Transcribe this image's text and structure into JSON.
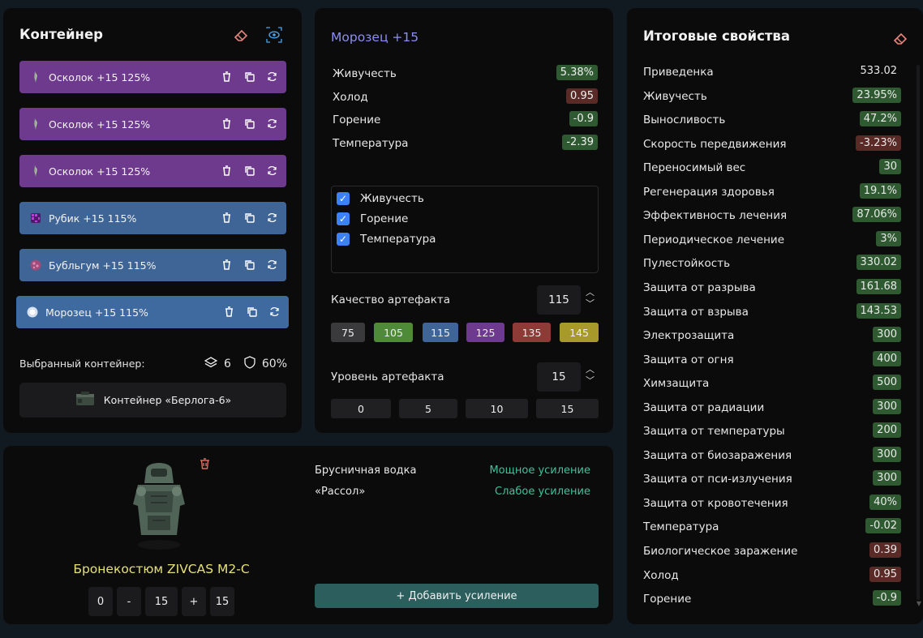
{
  "container": {
    "title": "Контейнер",
    "slots": [
      {
        "label": "Осколок +15 125%",
        "color": "#6d3a8e"
      },
      {
        "label": "Осколок +15 125%",
        "color": "#6d3a8e"
      },
      {
        "label": "Осколок +15 125%",
        "color": "#6d3a8e"
      },
      {
        "label": "Рубик +15 115%",
        "color": "#3f6596"
      },
      {
        "label": "Бубльгум +15 115%",
        "color": "#3f6596"
      },
      {
        "label": "Морозец +15 115%",
        "color": "#3f6aa0"
      }
    ],
    "selected_label": "Выбранный контейнер:",
    "slots_count": "6",
    "protection": "60%",
    "container_name": "Контейнер «Берлога-6»"
  },
  "artifact": {
    "title": "Морозец +15",
    "props": [
      {
        "name": "Живучесть",
        "value": "5.38%",
        "tone": "positive"
      },
      {
        "name": "Холод",
        "value": "0.95",
        "tone": "negative"
      },
      {
        "name": "Горение",
        "value": "-0.9",
        "tone": "positive"
      },
      {
        "name": "Температура",
        "value": "-2.39",
        "tone": "positive"
      }
    ],
    "checks": [
      {
        "label": "Живучесть",
        "checked": true
      },
      {
        "label": "Горение",
        "checked": true
      },
      {
        "label": "Температура",
        "checked": true
      }
    ],
    "quality_label": "Качество артефакта",
    "quality_value": "115",
    "quality_options": [
      {
        "label": "75",
        "color": "#3a3a3c"
      },
      {
        "label": "105",
        "color": "#4f8a3a"
      },
      {
        "label": "115",
        "color": "#3f6596"
      },
      {
        "label": "125",
        "color": "#6d3a8e"
      },
      {
        "label": "135",
        "color": "#8e3a36"
      },
      {
        "label": "145",
        "color": "#a89a2a"
      }
    ],
    "level_label": "Уровень артефакта",
    "level_value": "15",
    "level_options": [
      "0",
      "5",
      "10",
      "15"
    ]
  },
  "totals": {
    "title": "Итоговые свойства",
    "rows": [
      {
        "name": "Приведенка",
        "value": "533.02",
        "tone": "neutral"
      },
      {
        "name": "Живучесть",
        "value": "23.95%",
        "tone": "positive"
      },
      {
        "name": "Выносливость",
        "value": "47.2%",
        "tone": "positive"
      },
      {
        "name": "Скорость передвижения",
        "value": "-3.23%",
        "tone": "negative"
      },
      {
        "name": "Переносимый вес",
        "value": "30",
        "tone": "positive"
      },
      {
        "name": "Регенерация здоровья",
        "value": "19.1%",
        "tone": "positive"
      },
      {
        "name": "Эффективность лечения",
        "value": "87.06%",
        "tone": "positive"
      },
      {
        "name": "Периодическое лечение",
        "value": "3%",
        "tone": "positive"
      },
      {
        "name": "Пулестойкость",
        "value": "330.02",
        "tone": "positive"
      },
      {
        "name": "Защита от разрыва",
        "value": "161.68",
        "tone": "positive"
      },
      {
        "name": "Защита от взрыва",
        "value": "143.53",
        "tone": "positive"
      },
      {
        "name": "Электрозащита",
        "value": "300",
        "tone": "positive"
      },
      {
        "name": "Защита от огня",
        "value": "400",
        "tone": "positive"
      },
      {
        "name": "Химзащита",
        "value": "500",
        "tone": "positive"
      },
      {
        "name": "Защита от радиации",
        "value": "300",
        "tone": "positive"
      },
      {
        "name": "Защита от температуры",
        "value": "200",
        "tone": "positive"
      },
      {
        "name": "Защита от биозаражения",
        "value": "300",
        "tone": "positive"
      },
      {
        "name": "Защита от пси-излучения",
        "value": "300",
        "tone": "positive"
      },
      {
        "name": "Защита от кровотечения",
        "value": "40%",
        "tone": "positive"
      },
      {
        "name": "Температура",
        "value": "-0.02",
        "tone": "positive"
      },
      {
        "name": "Биологическое заражение",
        "value": "0.39",
        "tone": "negative"
      },
      {
        "name": "Холод",
        "value": "0.95",
        "tone": "negative"
      },
      {
        "name": "Горение",
        "value": "-0.9",
        "tone": "positive"
      }
    ]
  },
  "armor": {
    "name": "Бронекостюм ZIVCAS M2-C",
    "controls": {
      "min": "0",
      "minus": "-",
      "value": "15",
      "plus": "+",
      "max": "15"
    },
    "boosts": [
      {
        "name": "Брусничная водка",
        "effect": "Мощное усиление"
      },
      {
        "name": "«Рассол»",
        "effect": "Слабое усиление"
      }
    ],
    "add_label": "+ Добавить усиление"
  },
  "colors": {
    "positive": "#2f5a31",
    "negative": "#5a2a27",
    "accent": "#8d8ff0"
  }
}
